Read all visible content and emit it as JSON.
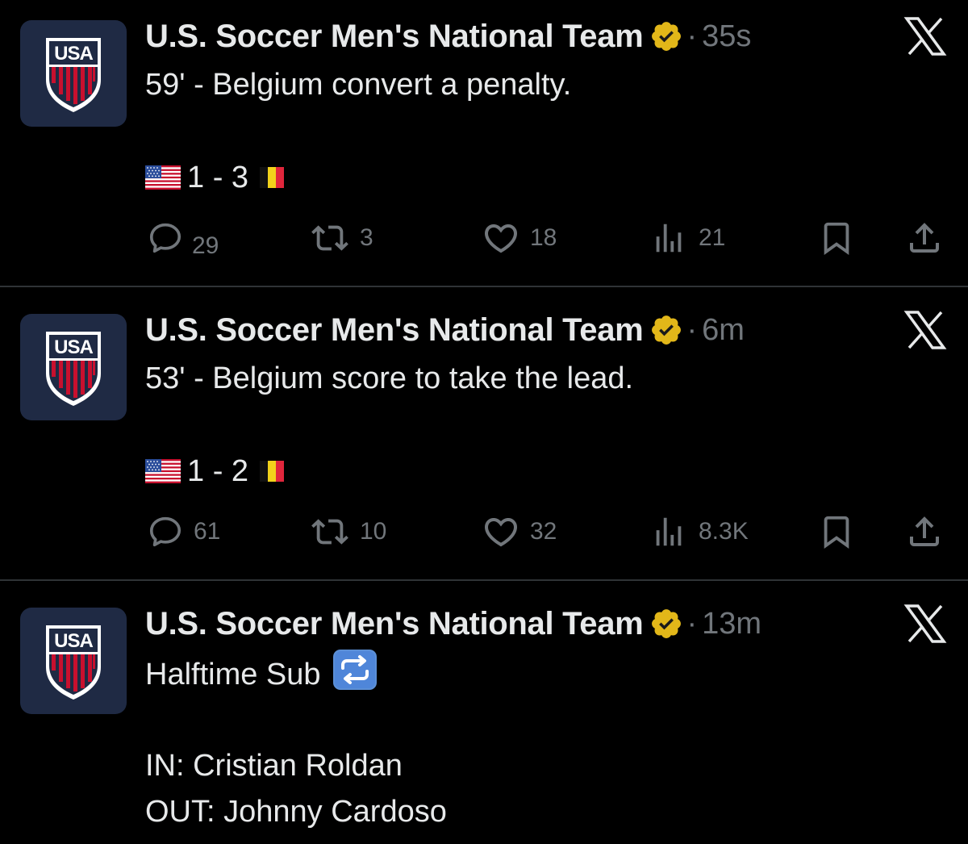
{
  "colors": {
    "background": "#000000",
    "text_primary": "#e7e9ea",
    "text_secondary": "#71767b",
    "verified_gold": "#e2b719",
    "avatar_bg": "#1f2a44",
    "divider": "#2f3336"
  },
  "tweets": [
    {
      "author": "U.S. Soccer Men's National Team",
      "separator": "·",
      "time": "35s",
      "text": "59' - Belgium convert a penalty.",
      "score": "1 - 3",
      "stats": {
        "replies": "29",
        "reposts": "3",
        "likes": "18",
        "views": "21"
      }
    },
    {
      "author": "U.S. Soccer Men's National Team",
      "separator": "·",
      "time": "6m",
      "text": "53' - Belgium score to take the lead.",
      "score": "1 - 2",
      "stats": {
        "replies": "61",
        "reposts": "10",
        "likes": "32",
        "views": "8.3K"
      }
    },
    {
      "author": "U.S. Soccer Men's National Team",
      "separator": "·",
      "time": "13m",
      "text": "Halftime Sub",
      "lines": [
        "IN: Cristian Roldan",
        "OUT: Johnny Cardoso"
      ]
    }
  ],
  "avatar_logo_text": "USA",
  "icons": [
    "usa-crest-icon",
    "verified-badge-icon",
    "x-logo-icon",
    "reply-icon",
    "repost-icon",
    "like-icon",
    "views-icon",
    "bookmark-icon",
    "share-icon",
    "us-flag-icon",
    "belgium-flag-icon",
    "repeat-emoji-icon"
  ]
}
